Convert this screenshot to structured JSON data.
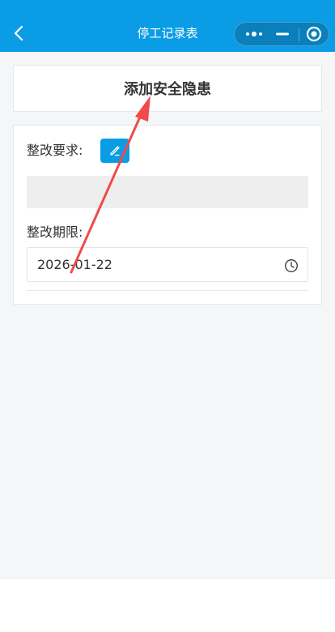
{
  "nav": {
    "title": "停工记录表",
    "back_icon": "chevron-left-icon",
    "more_icon": "more-dots-icon",
    "minimize_icon": "minus-icon",
    "close_icon": "target-circle-icon"
  },
  "section": {
    "title": "添加安全隐患"
  },
  "form": {
    "requirement_label": "整改要求:",
    "edit_icon": "pencil-icon",
    "requirement_value": "",
    "deadline_label": "整改期限:",
    "deadline_value": "2026-01-22",
    "clock_icon": "clock-icon"
  },
  "colors": {
    "accent": "#0b9ce6",
    "page_bg": "#f5f6f8",
    "annotation_arrow": "#ef4b4b"
  }
}
